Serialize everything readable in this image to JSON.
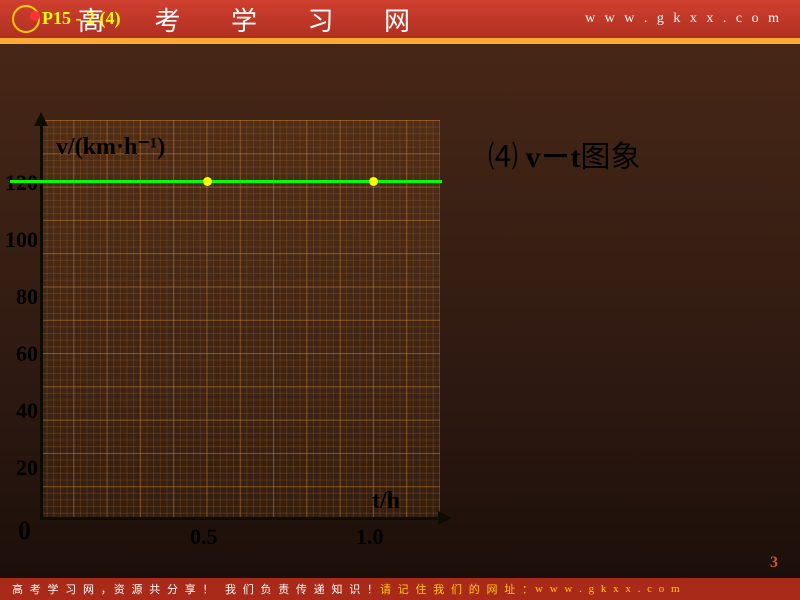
{
  "header": {
    "page_ref": "P15 - 2 (4)",
    "site_name": "高 考 学 习 网",
    "url": "w w w . g k x x . c o m"
  },
  "chart_data": {
    "type": "line",
    "title": "",
    "xlabel": "t/h",
    "ylabel": "v/(km·h⁻¹)",
    "x": [
      0,
      0.5,
      1.0
    ],
    "values": [
      120,
      120,
      120
    ],
    "marked_points": [
      {
        "x": 0.5,
        "y": 120
      },
      {
        "x": 1.0,
        "y": 120
      }
    ],
    "xticks": [
      "0.5",
      "1.0"
    ],
    "yticks": [
      "20",
      "40",
      "60",
      "80",
      "100",
      "120"
    ],
    "xlim": [
      0,
      1.2
    ],
    "ylim": [
      0,
      140
    ],
    "origin_label": "0"
  },
  "side_title": {
    "prefix": "⑷",
    "formula": "v－t",
    "suffix": "图象"
  },
  "page_number": "3",
  "footer": {
    "text1": "高 考 学 习 网 ，资 源 共 分 享 ！",
    "text2": "我 们 负 责 传 递 知 识 ！",
    "text3": "请 记 住 我 们 的 网 址 ：",
    "url": "w w w . g k x x . c o m"
  }
}
